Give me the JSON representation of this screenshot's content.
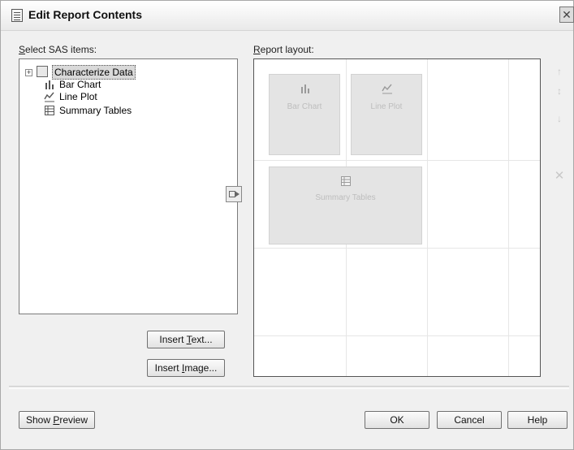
{
  "dialog": {
    "title": "Edit Report Contents",
    "close_glyph": "✕"
  },
  "left": {
    "label_prefix": "",
    "label_accel": "S",
    "label_rest": "elect SAS items:",
    "tree": [
      {
        "label": "Characterize Data",
        "icon": "task-folder-icon",
        "selected": true,
        "expandable": true
      },
      {
        "label": "Bar Chart",
        "icon": "bar-chart-icon"
      },
      {
        "label": "Line Plot",
        "icon": "line-plot-icon"
      },
      {
        "label": "Summary Tables",
        "icon": "table-icon"
      }
    ],
    "insert_text": {
      "before": "Insert ",
      "accel": "T",
      "after": "ext..."
    },
    "insert_image": {
      "before": "Insert ",
      "accel": "I",
      "after": "mage..."
    }
  },
  "right": {
    "label_accel": "R",
    "label_rest": "eport layout:",
    "cells": [
      {
        "label": "Bar Chart",
        "icon": "bar-chart-icon"
      },
      {
        "label": "Line Plot",
        "icon": "line-plot-icon"
      },
      {
        "label": "Summary Tables",
        "icon": "table-icon"
      }
    ]
  },
  "footer": {
    "show_preview": {
      "before": "Show ",
      "accel": "P",
      "after": "review"
    },
    "ok": "OK",
    "cancel": "Cancel",
    "help": "Help"
  },
  "colors": {
    "dialog_bg": "#f0f0f0",
    "selection_bg": "#d9d9d9",
    "placeholder_cell": "#e4e4e4"
  }
}
